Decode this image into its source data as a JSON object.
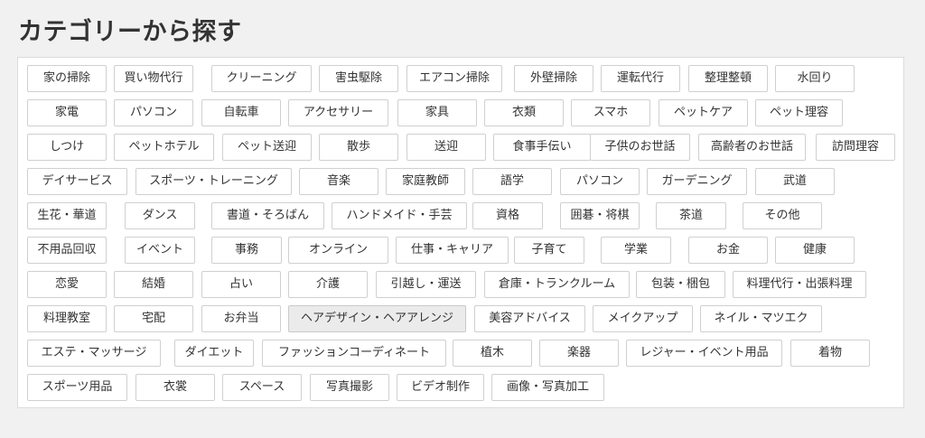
{
  "title": "カテゴリーから探す",
  "categories": [
    [
      "家の掃除",
      "買い物代行",
      "クリーニング",
      "害虫駆除",
      "エアコン掃除",
      "外壁掃除",
      "運転代行",
      "整理整頓",
      "水回り"
    ],
    [
      "家電",
      "パソコン",
      "自転車",
      "アクセサリー",
      "家具",
      "衣類",
      "スマホ",
      "ペットケア",
      "ペット理容"
    ],
    [
      "しつけ",
      "ペットホテル",
      "ペット送迎",
      "散歩",
      "送迎",
      "食事手伝い",
      "子供のお世話",
      "高齢者のお世話",
      "訪問理容"
    ],
    [
      "デイサービス",
      "スポーツ・トレーニング",
      "音楽",
      "家庭教師",
      "語学",
      "パソコン",
      "ガーデニング",
      "武道"
    ],
    [
      "生花・華道",
      "ダンス",
      "書道・そろばん",
      "ハンドメイド・手芸",
      "資格",
      "囲碁・将棋",
      "茶道",
      "その他"
    ],
    [
      "不用品回収",
      "イベント",
      "事務",
      "オンライン",
      "仕事・キャリア",
      "子育て",
      "学業",
      "お金",
      "健康"
    ],
    [
      "恋愛",
      "結婚",
      "占い",
      "介護",
      "引越し・運送",
      "倉庫・トランクルーム",
      "包装・梱包",
      "料理代行・出張料理"
    ],
    [
      "料理教室",
      "宅配",
      "お弁当",
      "ヘアデザイン・ヘアアレンジ",
      "美容アドバイス",
      "メイクアップ",
      "ネイル・マツエク"
    ],
    [
      "エステ・マッサージ",
      "ダイエット",
      "ファッションコーディネート",
      "植木",
      "楽器",
      "レジャー・イベント用品",
      "着物"
    ],
    [
      "スポーツ用品",
      "衣裳",
      "スペース",
      "写真撮影",
      "ビデオ制作",
      "画像・写真加工"
    ]
  ],
  "active_category": "ヘアデザイン・ヘアアレンジ"
}
